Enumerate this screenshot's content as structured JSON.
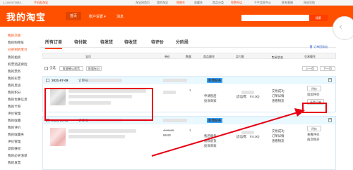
{
  "topbar": {
    "username": "t_1491573583...",
    "mobile": "手机逛淘宝",
    "links": [
      "淘宝网首页",
      "我的淘宝",
      "购物车",
      "收藏夹",
      "商品分类",
      "免费开店",
      "千牛卖家中心",
      "联系客服",
      "网站导航"
    ]
  },
  "header": {
    "logo": "我的淘宝",
    "home": "首页",
    "settings": "账户设置",
    "messages": "消息",
    "search_placeholder": "",
    "search_btn": "搜索"
  },
  "sidebar": {
    "title": "我的交易",
    "items": [
      "我的购物车",
      "已买到的宝贝",
      "我的拍卖",
      "机票酒店保险",
      "我的票务",
      "我的彩票",
      "我的足迹",
      "我的积分",
      "我的优惠信息",
      "我的卡券",
      "评价管理",
      "我的收藏",
      "我的评价",
      "我的收藏夹",
      "评价管理",
      "退款维权",
      "我的必买清单",
      "我的发票"
    ]
  },
  "tabs": [
    "所有订单",
    "待付款",
    "待发货",
    "待收货",
    "待评价",
    "分阶段"
  ],
  "tab_recycle": "订单回收站",
  "columns": [
    "宝贝",
    "单价",
    "数量",
    "商品操作",
    "实付款",
    "交易状态",
    "交易操作"
  ],
  "batchbar": {
    "select_all": "全选",
    "merge_pay": "批量确认收货",
    "batch_label": "批量标记",
    "prev": "上一页",
    "next": "下一页"
  },
  "orders": [
    {
      "date": "2021-07-08",
      "order_no": "订单号",
      "badge": "和我联系",
      "qty": "1",
      "ops": [
        "申请售后",
        "投诉商家"
      ],
      "total": "(含运费：￥0.00)",
      "status": [
        "交易成功",
        "订单详情",
        "查看物流"
      ],
      "actions": [
        "评价",
        "追加评价",
        "还要订购"
      ],
      "highlight_action": "还要订单"
    },
    {
      "date": "2021-05-03",
      "order_no": "订单号",
      "badge": "和我联系",
      "price_old": "￥99.00",
      "price_new": "69.92",
      "qty": "1",
      "ops": [
        "售后服务",
        "退款退货",
        "投诉商家"
      ],
      "total": "(含运费：￥0.00)",
      "status": [
        "交易成功",
        "订单详情",
        "查看物流"
      ],
      "actions": [
        "评价",
        "查看评价",
        "再次购买"
      ]
    }
  ]
}
